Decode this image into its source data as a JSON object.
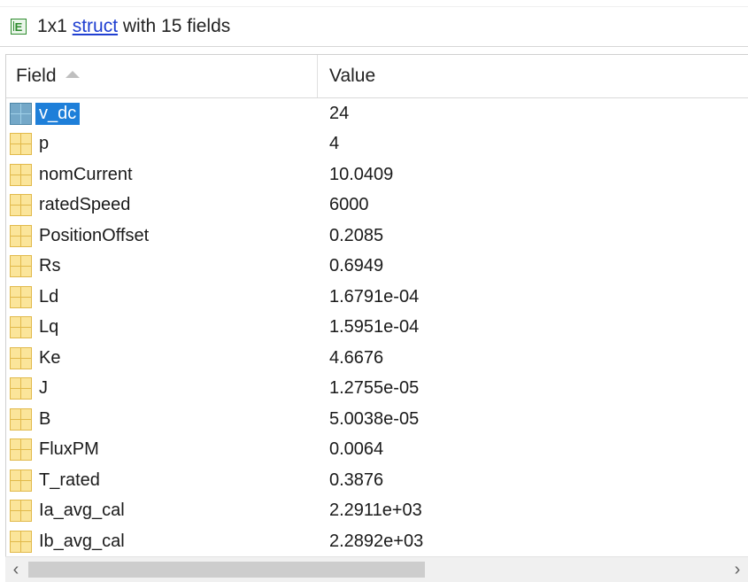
{
  "header": {
    "prefix": "1x1 ",
    "link": "struct",
    "suffix": " with 15 fields"
  },
  "columns": {
    "field": "Field",
    "value": "Value"
  },
  "rows": [
    {
      "field": "v_dc",
      "value": "24"
    },
    {
      "field": "p",
      "value": "4"
    },
    {
      "field": "nomCurrent",
      "value": "10.0409"
    },
    {
      "field": "ratedSpeed",
      "value": "6000"
    },
    {
      "field": "PositionOffset",
      "value": "0.2085"
    },
    {
      "field": "Rs",
      "value": "0.6949"
    },
    {
      "field": "Ld",
      "value": "1.6791e-04"
    },
    {
      "field": "Lq",
      "value": "1.5951e-04"
    },
    {
      "field": "Ke",
      "value": "4.6676"
    },
    {
      "field": "J",
      "value": "1.2755e-05"
    },
    {
      "field": "B",
      "value": "5.0038e-05"
    },
    {
      "field": "FluxPM",
      "value": "0.0064"
    },
    {
      "field": "T_rated",
      "value": "0.3876"
    },
    {
      "field": "Ia_avg_cal",
      "value": "2.2911e+03"
    },
    {
      "field": "Ib_avg_cal",
      "value": "2.2892e+03"
    }
  ],
  "selected_row": 0,
  "icons": {
    "header": "struct-icon",
    "row": "field-grid-icon",
    "sort": "sort-ascending-icon",
    "scroll_left": "chevron-left-icon",
    "scroll_right": "chevron-right-icon"
  },
  "colors": {
    "selection": "#1e7fd9",
    "link": "#1f3fd1",
    "field_icon": "#fbe59a"
  }
}
